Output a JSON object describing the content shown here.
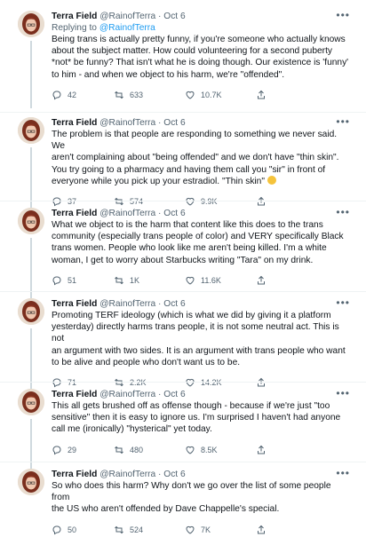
{
  "author": {
    "name": "Terra Field",
    "handle": "@RainofTerra",
    "separator": "·",
    "date": "Oct 6"
  },
  "more_label": "•••",
  "replying_prefix": "Replying to ",
  "replying_handle": "@RainofTerra",
  "icons": {
    "reply": "reply-icon",
    "retweet": "retweet-icon",
    "like": "heart-icon",
    "share": "share-icon"
  },
  "colors": {
    "link": "#1d9bf0",
    "muted": "#536471"
  },
  "tweets": [
    {
      "text": "Being trans is actually pretty funny, if you're someone who actually knows\nabout the subject matter. How could volunteering for a second puberty\n*not* be funny? That isn't what he is doing though. Our existence is 'funny'\nto him - and when we object to his harm, we're \"offended\".",
      "replies": "42",
      "retweets": "633",
      "likes": "10.7K"
    },
    {
      "text": "The problem is that people are responding to something we never said. We\naren't complaining about \"being offended\" and we don't have \"thin skin\".\nYou try going to a pharmacy and having them call you \"sir\" in front of\neveryone while you pick up your estradiol. \"Thin skin\"",
      "replies": "37",
      "retweets": "574",
      "likes": "9.9K"
    },
    {
      "text": "What we object to is the harm that content like this does to the trans\ncommunity (especially trans people of color) and VERY specifically Black\ntrans women. People who look like me aren't being killed. I'm a white\nwoman, I get to worry about Starbucks writing \"Tara\" on my drink.",
      "replies": "51",
      "retweets": "1K",
      "likes": "11.6K"
    },
    {
      "text": "Promoting TERF ideology (which is what we did by giving it a platform\nyesterday) directly harms trans people, it is not some neutral act. This is not\nan argument with two sides. It is an argument with trans people who want\nto be alive and people who don't want us to be.",
      "replies": "71",
      "retweets": "2.2K",
      "likes": "14.2K"
    },
    {
      "text": "This all gets brushed off as offense though - because if we're just \"too\nsensitive\" then it is easy to ignore us. I'm surprised I haven't had anyone\ncall me (ironically) \"hysterical\" yet today.",
      "replies": "29",
      "retweets": "480",
      "likes": "8.5K"
    },
    {
      "text": "So who does this harm? Why don't we go over the list of some people from\nthe US who aren't offended by Dave Chappelle's special.",
      "replies": "50",
      "retweets": "524",
      "likes": "7K"
    }
  ]
}
